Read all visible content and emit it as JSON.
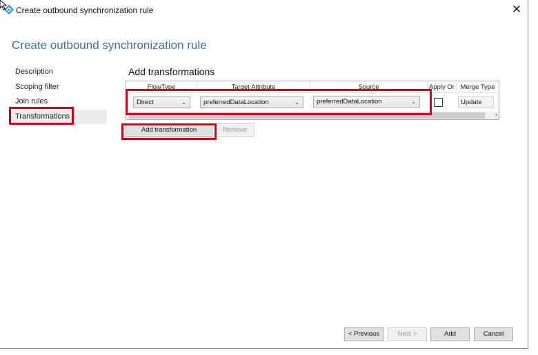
{
  "window": {
    "title": "Create outbound synchronization rule",
    "close_label": "✕"
  },
  "header": {
    "page_title": "Create outbound synchronization rule"
  },
  "nav": {
    "items": [
      {
        "label": "Description"
      },
      {
        "label": "Scoping filter"
      },
      {
        "label": "Join rules"
      },
      {
        "label": "Transformations",
        "active": true
      }
    ]
  },
  "main": {
    "section_title": "Add transformations",
    "columns": [
      "FlowType",
      "Target Attribute",
      "Source",
      "Apply Or",
      "Merge Type"
    ],
    "row": {
      "flow_type": "Direct",
      "target_attribute": "preferredDataLocation",
      "source": "preferredDataLocation",
      "apply_once": false,
      "merge_type": "Update"
    },
    "add_transformation_label": "Add transformation",
    "remove_label": "Remove"
  },
  "footer": {
    "previous_label": "< Previous",
    "next_label": "Next >",
    "add_label": "Add",
    "cancel_label": "Cancel"
  },
  "colors": {
    "accent": "#3d6fa8",
    "highlight": "#d0021b"
  }
}
